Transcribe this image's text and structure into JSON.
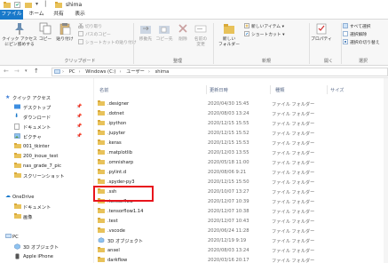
{
  "window": {
    "title": "shima"
  },
  "tabs": [
    "ファイル",
    "ホーム",
    "共有",
    "表示"
  ],
  "ribbon": {
    "clipboard": {
      "quick_access": "クイック アクセス\nにピン留めする",
      "copy": "コピー",
      "paste": "貼り付け",
      "cut": "切り取り",
      "copy_path": "パスのコピー",
      "paste_shortcut": "ショートカットの貼り付け",
      "label": "クリップボード"
    },
    "organize": {
      "move_to": "移動先",
      "copy_to": "コピー先",
      "delete": "削除",
      "rename": "名前の\n変更",
      "label": "整理"
    },
    "new": {
      "new_folder": "新しい\nフォルダー",
      "new_item": "新しいアイテム",
      "easy_access": "ショートカット",
      "label": "新規"
    },
    "open": {
      "properties": "プロパティ",
      "label": "開く"
    },
    "select": {
      "select_all": "すべて選択",
      "select_none": "選択解除",
      "invert": "選択の切り替え",
      "label": "選択"
    }
  },
  "address": {
    "crumbs": [
      "PC",
      "Windows (C:)",
      "ユーザー",
      "shima"
    ]
  },
  "nav": {
    "quick_access": "クイック アクセス",
    "items": [
      "デスクトップ",
      "ダウンロード",
      "ドキュメント",
      "ピクチャ",
      "001_tkinter",
      "200_inoue_test",
      "nas_grade_7_pic",
      "スクリーンショット"
    ],
    "onedrive": "OneDrive",
    "onedrive_items": [
      "ドキュメント",
      "画像"
    ],
    "pc": "PC",
    "pc_items": [
      "3D オブジェクト",
      "Apple iPhone"
    ]
  },
  "columns": {
    "name": "名前",
    "date": "更新日時",
    "type": "種類",
    "size": "サイズ"
  },
  "files": [
    {
      "name": ".designer",
      "date": "2020/04/30 15:45",
      "type": "ファイル フォルダー"
    },
    {
      "name": ".dotnet",
      "date": "2020/08/03 13:24",
      "type": "ファイル フォルダー"
    },
    {
      "name": ".ipython",
      "date": "2020/12/15 15:55",
      "type": "ファイル フォルダー"
    },
    {
      "name": ".jupyter",
      "date": "2020/12/15 15:52",
      "type": "ファイル フォルダー"
    },
    {
      "name": ".keras",
      "date": "2020/12/15 15:53",
      "type": "ファイル フォルダー"
    },
    {
      "name": ".matplotlib",
      "date": "2020/12/03 13:55",
      "type": "ファイル フォルダー"
    },
    {
      "name": ".omnisharp",
      "date": "2020/05/18 11:00",
      "type": "ファイル フォルダー"
    },
    {
      "name": ".pylint.d",
      "date": "2020/08/06 9:21",
      "type": "ファイル フォルダー"
    },
    {
      "name": ".spyder-py3",
      "date": "2020/12/15 15:50",
      "type": "ファイル フォルダー"
    },
    {
      "name": ".ssh",
      "date": "2020/10/07 13:27",
      "type": "ファイル フォルダー"
    },
    {
      "name": ".tensorflow",
      "date": "2020/12/07 10:39",
      "type": "ファイル フォルダー"
    },
    {
      "name": ".tensorflow1.14",
      "date": "2020/12/07 10:38",
      "type": "ファイル フォルダー"
    },
    {
      "name": ".test",
      "date": "2020/12/07 10:43",
      "type": "ファイル フォルダー"
    },
    {
      "name": ".vscode",
      "date": "2020/06/24 11:28",
      "type": "ファイル フォルダー"
    },
    {
      "name": "3D オブジェクト",
      "date": "2020/12/19 9:19",
      "type": "ファイル フォルダー"
    },
    {
      "name": "ansel",
      "date": "2020/08/03 13:24",
      "type": "ファイル フォルダー"
    },
    {
      "name": "darkflow",
      "date": "2020/03/16 20:17",
      "type": "ファイル フォルダー"
    }
  ],
  "colors": {
    "accent": "#1979ca",
    "folder": "#e8c25a",
    "highlight": "#e8141c"
  }
}
